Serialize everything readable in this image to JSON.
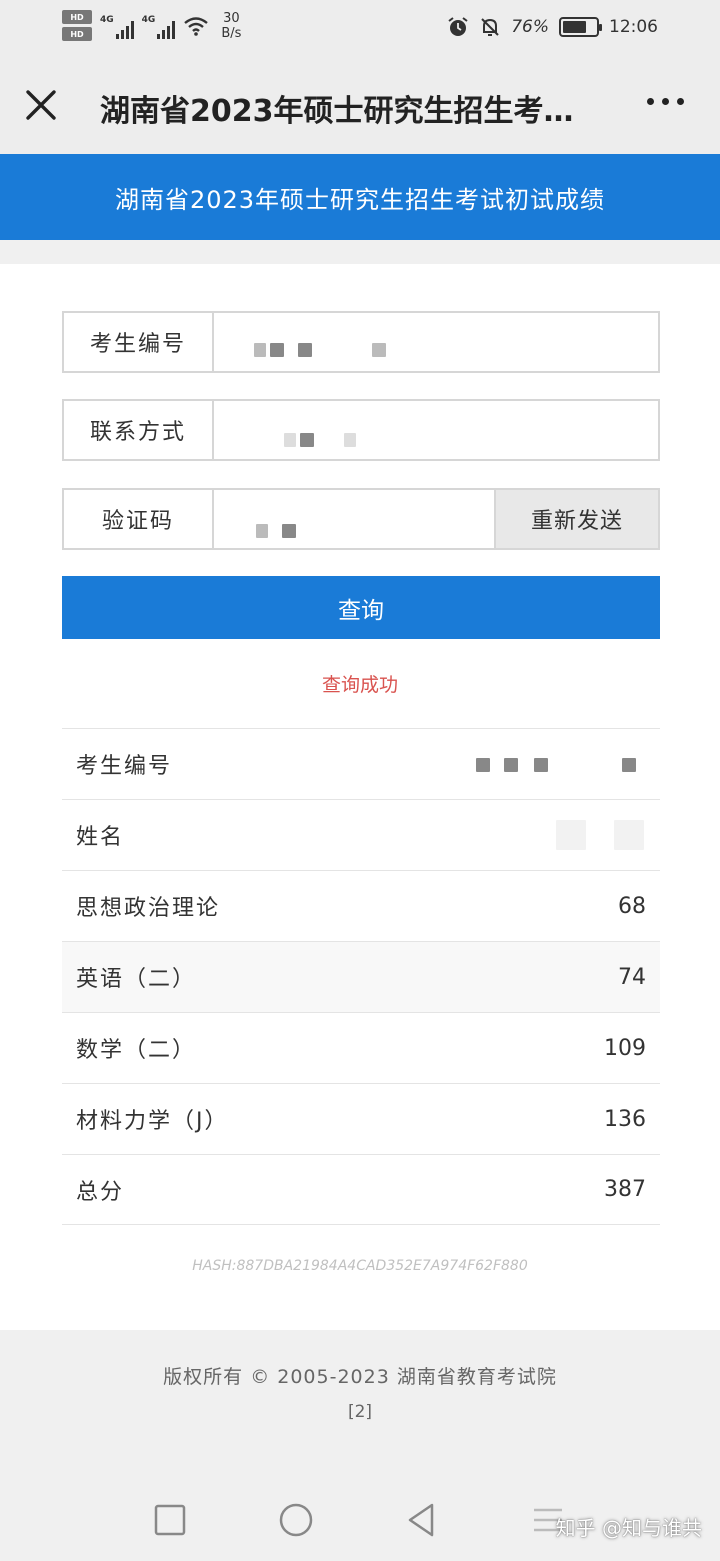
{
  "status_bar": {
    "hd_badge": "HD",
    "signal_label": "4G",
    "net_speed_value": "30",
    "net_speed_unit": "B/s",
    "battery_text": "76%",
    "battery_level": 0.76,
    "time": "12:06"
  },
  "titlebar": {
    "title": "湖南省2023年硕士研究生招生考试初试成绩"
  },
  "banner": {
    "text": "湖南省2023年硕士研究生招生考试初试成绩"
  },
  "form": {
    "exam_no_label": "考生编号",
    "contact_label": "联系方式",
    "captcha_label": "验证码",
    "resend_label": "重新发送",
    "query_label": "查询",
    "success_text": "查询成功"
  },
  "results": [
    {
      "label": "考生编号",
      "value": ""
    },
    {
      "label": "姓名",
      "value": ""
    },
    {
      "label": "思想政治理论",
      "value": "68"
    },
    {
      "label": "英语（二）",
      "value": "74"
    },
    {
      "label": "数学（二）",
      "value": "109"
    },
    {
      "label": "材料力学（J）",
      "value": "136"
    },
    {
      "label": "总分",
      "value": "387"
    }
  ],
  "hash_text": "HASH:887DBA21984A4CAD352E7A974F62F880",
  "footer": {
    "copyright": "版权所有 © 2005-2023 湖南省教育考试院",
    "page_num": "[2]"
  },
  "watermark": "知乎 @知与谁共",
  "colors": {
    "accent": "#1a7bd7",
    "success": "#d9534f"
  }
}
